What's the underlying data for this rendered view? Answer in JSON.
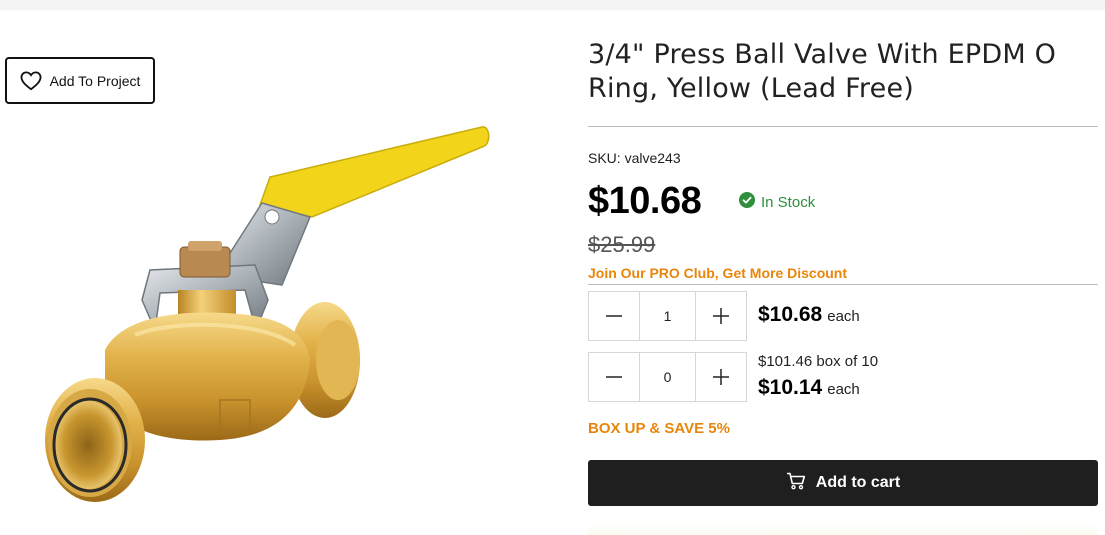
{
  "add_to_project": {
    "label": "Add To Project",
    "icon": "heart-icon"
  },
  "product": {
    "title": "3/4\" Press Ball Valve With EPDM O Ring, Yellow (Lead Free)",
    "sku_label": "SKU:",
    "sku": "valve243",
    "price": "$10.68",
    "stock_status": "In Stock",
    "stock_color": "#2f8f3c",
    "old_price": "$25.99",
    "pro_club_link": "Join Our PRO Club, Get More Discount",
    "accent_color": "#e8860b"
  },
  "purchase": {
    "single": {
      "qty": "1",
      "price": "$10.68",
      "unit": "each"
    },
    "box": {
      "qty": "0",
      "box_price": "$101.46 box of 10",
      "price": "$10.14",
      "unit": "each"
    },
    "box_promo": "BOX UP & SAVE 5%",
    "add_to_cart_label": "Add to cart",
    "add_to_cart_icon": "cart-icon"
  }
}
